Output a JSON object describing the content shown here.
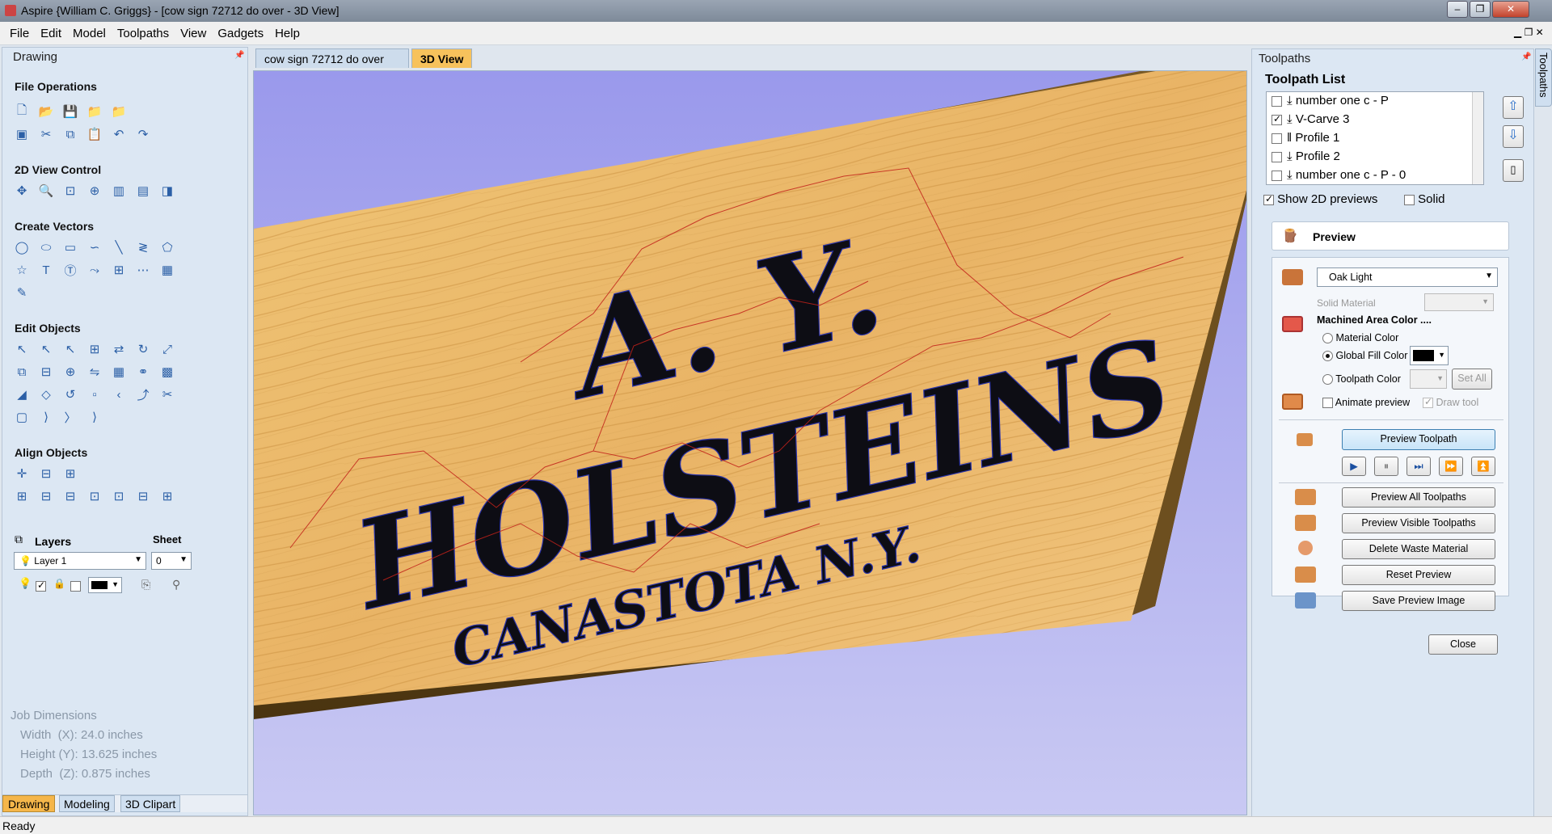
{
  "window": {
    "title": "Aspire {William C. Griggs} - [cow sign 72712 do over - 3D View]",
    "minimize": "–",
    "maximize": "❐",
    "close": "✕"
  },
  "menu": [
    "File",
    "Edit",
    "Model",
    "Toolpaths",
    "View",
    "Gadgets",
    "Help"
  ],
  "drawing_panel": {
    "title": "Drawing",
    "sections": {
      "file_operations": "File Operations",
      "view_control": "2D View Control",
      "create_vectors": "Create Vectors",
      "edit_objects": "Edit Objects",
      "align_objects": "Align Objects"
    },
    "layers_label": "Layers",
    "sheet_label": "Sheet",
    "layer_value": "Layer 1",
    "sheet_value": "0",
    "job": {
      "title": "Job Dimensions",
      "width": "Width  (X): 24.0 inches",
      "height": "Height (Y): 13.625 inches",
      "depth": "Depth  (Z): 0.875 inches"
    },
    "bottom_tabs": [
      "Drawing",
      "Modeling",
      "3D Clipart"
    ]
  },
  "view_tabs": [
    "cow sign 72712 do over",
    "3D View"
  ],
  "sign": {
    "line1": "A. Y.",
    "line2": "HOLSTEINS",
    "line3": "CANASTOTA N.Y."
  },
  "toolpaths_panel": {
    "title": "Toolpaths",
    "side_tab": "Toolpaths",
    "list_title": "Toolpath List",
    "items": [
      {
        "label": "number one c - P",
        "checked": false
      },
      {
        "label": "V-Carve 3",
        "checked": true
      },
      {
        "label": "Profile 1",
        "checked": false
      },
      {
        "label": "Profile 2",
        "checked": false
      },
      {
        "label": "number one c - P - 0",
        "checked": false
      }
    ],
    "show_2d": "Show 2D previews",
    "solid": "Solid",
    "preview_title": "Preview",
    "material": "Oak Light",
    "solid_material": "Solid Material",
    "machined_area": "Machined Area Color ....",
    "material_color": "Material Color",
    "global_fill": "Global Fill Color",
    "toolpath_color": "Toolpath Color",
    "set_all": "Set All",
    "animate": "Animate preview",
    "draw_tool": "Draw tool",
    "buttons": {
      "preview_toolpath": "Preview Toolpath",
      "preview_all": "Preview All Toolpaths",
      "preview_visible": "Preview Visible Toolpaths",
      "delete_waste": "Delete Waste Material",
      "reset": "Reset Preview",
      "save_image": "Save Preview Image",
      "close": "Close"
    }
  },
  "status": "Ready",
  "colors": {
    "panel": "#dce7f3",
    "wood": "#e9b86a",
    "sky": "#a9a8ee",
    "accent": "#f5b64a"
  }
}
